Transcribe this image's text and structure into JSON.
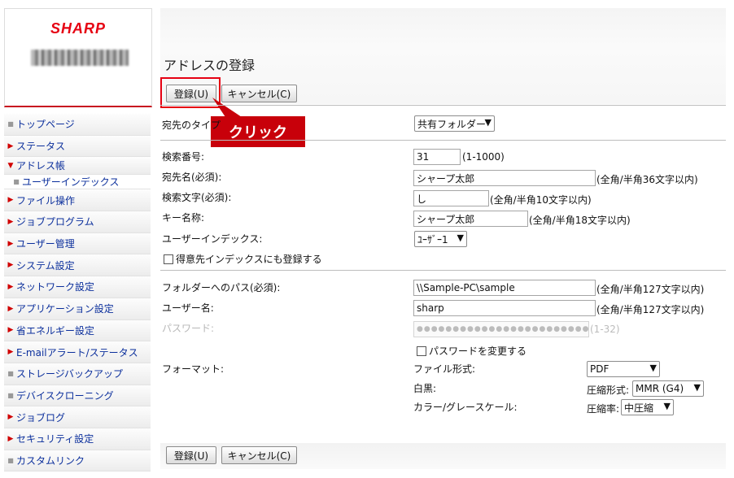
{
  "brand": {
    "name": "SHARP"
  },
  "sidebar": {
    "items": [
      {
        "label": "トップページ",
        "icon": "square-bullet-icon"
      },
      {
        "label": "ステータス",
        "icon": "triangle-right-icon"
      },
      {
        "label": "アドレス帳",
        "icon": "triangle-down-icon"
      },
      {
        "label": "ユーザーインデックス",
        "icon": "square-bullet-icon"
      },
      {
        "label": "ファイル操作",
        "icon": "triangle-right-icon"
      },
      {
        "label": "ジョブプログラム",
        "icon": "triangle-right-icon"
      },
      {
        "label": "ユーザー管理",
        "icon": "triangle-right-icon"
      },
      {
        "label": "システム設定",
        "icon": "triangle-right-icon"
      },
      {
        "label": "ネットワーク設定",
        "icon": "triangle-right-icon"
      },
      {
        "label": "アプリケーション設定",
        "icon": "triangle-right-icon"
      },
      {
        "label": "省エネルギー設定",
        "icon": "triangle-right-icon"
      },
      {
        "label": "E-mailアラート/ステータス",
        "icon": "triangle-right-icon"
      },
      {
        "label": "ストレージバックアップ",
        "icon": "square-bullet-icon"
      },
      {
        "label": "デバイスクローニング",
        "icon": "square-bullet-icon"
      },
      {
        "label": "ジョブログ",
        "icon": "triangle-right-icon"
      },
      {
        "label": "セキュリティ設定",
        "icon": "triangle-right-icon"
      },
      {
        "label": "カスタムリンク",
        "icon": "square-bullet-icon"
      }
    ]
  },
  "page": {
    "title": "アドレスの登録"
  },
  "toolbar": {
    "register_label": "登録(U)",
    "cancel_label": "キャンセル(C)"
  },
  "callout": {
    "text": "クリック"
  },
  "form": {
    "dest_type": {
      "label": "宛先のタイプ",
      "value": "共有フォルダー"
    },
    "search_number": {
      "label": "検索番号:",
      "value": "31",
      "hint": "(1-1000)"
    },
    "dest_name": {
      "label": "宛先名(必須):",
      "value": "シャープ太郎",
      "hint": "(全角/半角36文字以内)"
    },
    "search_char": {
      "label": "検索文字(必須):",
      "value": "し",
      "hint": "(全角/半角10文字以内)"
    },
    "key_name": {
      "label": "キー名称:",
      "value": "シャープ太郎",
      "hint": "(全角/半角18文字以内)"
    },
    "user_index": {
      "label": "ユーザーインデックス:",
      "value": "ﾕｰｻﾞｰ1"
    },
    "favorite": {
      "label": "得意先インデックスにも登録する",
      "checked": false
    },
    "folder_path": {
      "label": "フォルダーへのパス(必須):",
      "value": "\\\\Sample-PC\\sample",
      "hint": "(全角/半角127文字以内)"
    },
    "user_name": {
      "label": "ユーザー名:",
      "value": "sharp",
      "hint": "(全角/半角127文字以内)"
    },
    "password": {
      "label": "パスワード:",
      "value": "●●●●●●●●●●●●●●●●●●●●●●●●●●●",
      "hint": "(1-32)"
    },
    "change_password": {
      "label": "パスワードを変更する",
      "checked": false
    },
    "format": {
      "label": "フォーマット:",
      "file_type_label": "ファイル形式:",
      "file_type_value": "PDF",
      "bw_label": "白黒:",
      "bw_compression_label": "圧縮形式:",
      "bw_compression_value": "MMR (G4)",
      "color_label": "カラー/グレースケール:",
      "color_ratio_label": "圧縮率:",
      "color_ratio_value": "中圧縮"
    }
  },
  "colors": {
    "brand_red": "#e60012",
    "link_blue": "#0b2f9c",
    "callout_red": "#c8000a"
  }
}
